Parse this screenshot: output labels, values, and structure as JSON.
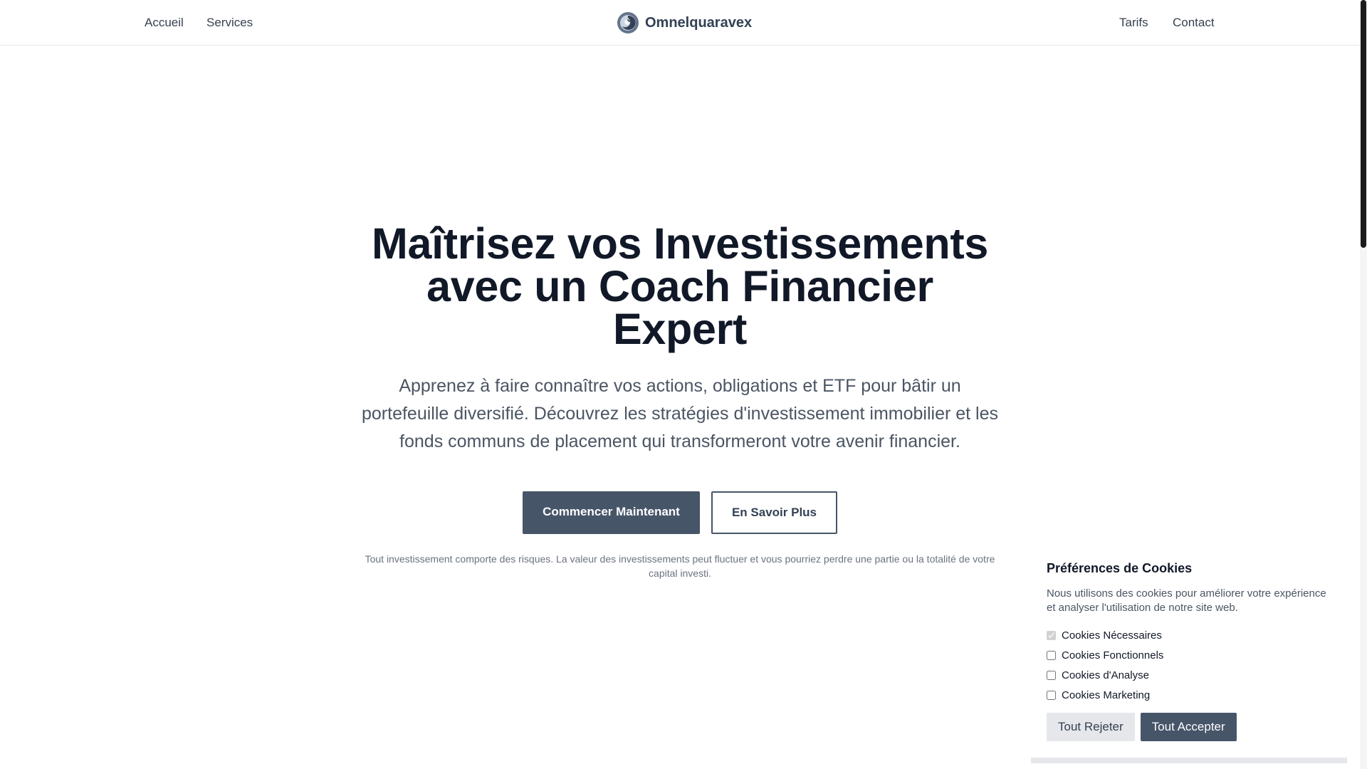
{
  "header": {
    "nav_left": [
      {
        "label": "Accueil"
      },
      {
        "label": "Services"
      }
    ],
    "brand": {
      "name": "Omnelquaravex",
      "logo_icon": "swirl-logo-icon"
    },
    "nav_right": [
      {
        "label": "Tarifs"
      },
      {
        "label": "Contact"
      }
    ]
  },
  "hero": {
    "title_lines": [
      "Maîtrisez vos Investissements",
      "avec un Coach Financier",
      "Expert"
    ],
    "subtitle": "Apprenez à faire connaître vos actions, obligations et ETF pour bâtir un portefeuille diversifié. Découvrez les stratégies d'investissement immobilier et les fonds communs de placement qui transformeront votre avenir financier.",
    "primary_cta": "Commencer Maintenant",
    "secondary_cta": "En Savoir Plus",
    "disclaimer": "Tout investissement comporte des risques. La valeur des investissements peut fluctuer et vous pourriez perdre une partie ou la totalité de votre capital investi."
  },
  "cookie_panel": {
    "title": "Préférences de Cookies",
    "description": "Nous utilisons des cookies pour améliorer votre expérience et analyser l'utilisation de notre site web.",
    "options": [
      {
        "label": "Cookies Nécessaires",
        "checked": true,
        "disabled": true
      },
      {
        "label": "Cookies Fonctionnels",
        "checked": false,
        "disabled": false
      },
      {
        "label": "Cookies d'Analyse",
        "checked": false,
        "disabled": false
      },
      {
        "label": "Cookies Marketing",
        "checked": false,
        "disabled": false
      }
    ],
    "reject_label": "Tout Rejeter",
    "accept_label": "Tout Accepter"
  },
  "colors": {
    "primary": "#475569",
    "text_dark": "#111827",
    "text_muted": "#4b5563",
    "border": "#e5e7eb"
  }
}
